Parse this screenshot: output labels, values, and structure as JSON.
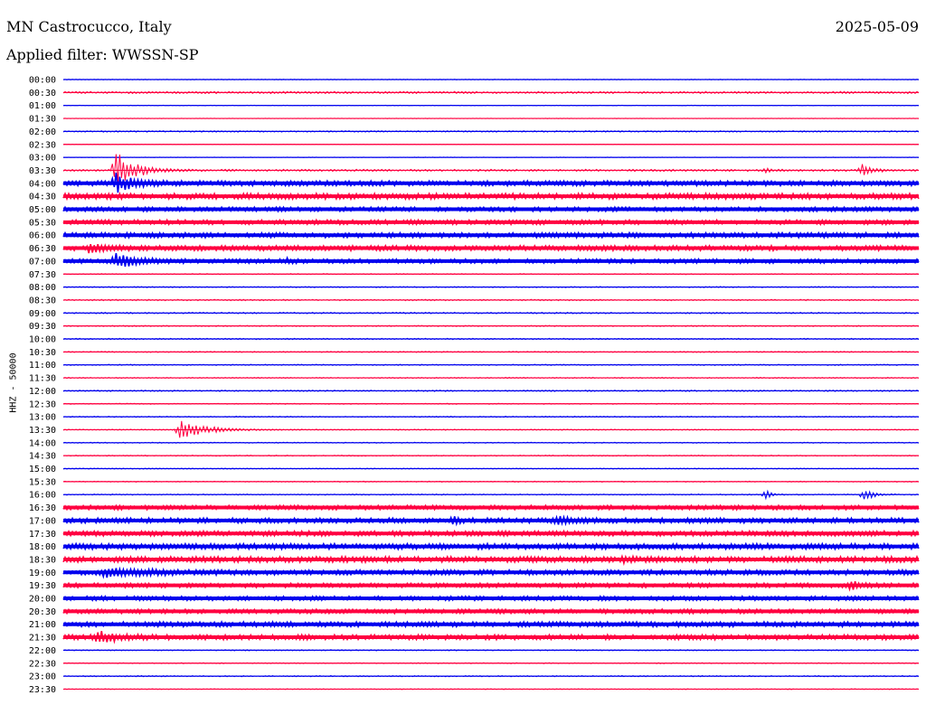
{
  "header": {
    "station": "MN Castrocucco, Italy",
    "date": "2025-05-09",
    "filter": "Applied filter: WWSSN-SP"
  },
  "channel": "HHZ - 50000",
  "colors": {
    "even": "#0000ee",
    "odd": "#ff0040",
    "background": "#ffffff",
    "text": "#000000"
  },
  "chart_data": {
    "type": "line",
    "title": "MN Castrocucco, Italy",
    "xlabel": "",
    "ylabel": "HHZ - 50000",
    "grid": false,
    "legend": "none",
    "tick_labels": [
      "00:00",
      "00:30",
      "01:00",
      "01:30",
      "02:00",
      "02:30",
      "03:00",
      "03:30",
      "04:00",
      "04:30",
      "05:00",
      "05:30",
      "06:00",
      "06:30",
      "07:00",
      "07:30",
      "08:00",
      "08:30",
      "09:00",
      "09:30",
      "10:00",
      "10:30",
      "11:00",
      "11:30",
      "12:00",
      "12:30",
      "13:00",
      "13:30",
      "14:00",
      "14:30",
      "15:00",
      "15:30",
      "16:00",
      "16:30",
      "17:00",
      "17:30",
      "18:00",
      "18:30",
      "19:00",
      "19:30",
      "20:00",
      "20:30",
      "21:00",
      "21:30",
      "22:00",
      "22:30",
      "23:00",
      "23:30"
    ],
    "noise_level": [
      0.5,
      1.5,
      0.4,
      0.4,
      1.0,
      0.4,
      0.4,
      1.5,
      3.5,
      4.0,
      3.0,
      3.2,
      3.5,
      3.5,
      3.0,
      0.7,
      0.8,
      1.0,
      1.0,
      0.8,
      1.0,
      0.8,
      0.8,
      0.8,
      1.0,
      0.7,
      0.8,
      0.8,
      0.7,
      0.7,
      0.7,
      0.7,
      0.8,
      3.0,
      3.5,
      3.5,
      4.0,
      4.0,
      3.5,
      3.0,
      3.0,
      3.0,
      3.5,
      3.5,
      0.8,
      0.7,
      0.8,
      0.6
    ],
    "events": [
      {
        "trace": "03:30",
        "x": 0.06,
        "amp": 48,
        "dur": 0.02
      },
      {
        "trace": "04:00",
        "x": 0.06,
        "amp": 24,
        "dur": 0.02
      },
      {
        "trace": "06:30",
        "x": 0.028,
        "amp": 10,
        "dur": 0.02
      },
      {
        "trace": "07:00",
        "x": 0.06,
        "amp": 20,
        "dur": 0.02
      },
      {
        "trace": "07:00",
        "x": 0.26,
        "amp": 8,
        "dur": 0.005
      },
      {
        "trace": "03:30",
        "x": 0.82,
        "amp": 6,
        "dur": 0.005
      },
      {
        "trace": "03:30",
        "x": 0.933,
        "amp": 14,
        "dur": 0.01
      },
      {
        "trace": "13:30",
        "x": 0.135,
        "amp": 22,
        "dur": 0.03
      },
      {
        "trace": "16:00",
        "x": 0.82,
        "amp": 16,
        "dur": 0.006
      },
      {
        "trace": "16:00",
        "x": 0.935,
        "amp": 16,
        "dur": 0.01
      },
      {
        "trace": "17:00",
        "x": 0.455,
        "amp": 8,
        "dur": 0.005
      },
      {
        "trace": "17:00",
        "x": 0.575,
        "amp": 8,
        "dur": 0.02
      },
      {
        "trace": "18:30",
        "x": 0.655,
        "amp": 6,
        "dur": 0.005
      },
      {
        "trace": "19:00",
        "x": 0.045,
        "amp": 8,
        "dur": 0.05
      },
      {
        "trace": "19:30",
        "x": 0.92,
        "amp": 16,
        "dur": 0.006
      },
      {
        "trace": "21:30",
        "x": 0.04,
        "amp": 14,
        "dur": 0.02
      }
    ]
  }
}
